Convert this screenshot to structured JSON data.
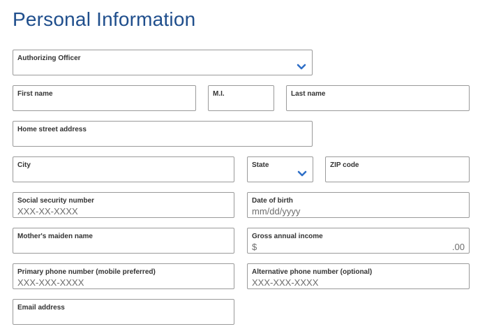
{
  "page": {
    "title": "Personal Information"
  },
  "colors": {
    "title": "#1f4e8c",
    "border": "#9a9a9a",
    "chevron": "#2f6fc7"
  },
  "fields": {
    "officer": {
      "label": "Authorizing Officer",
      "icon": "chevron-down-icon"
    },
    "first_name": {
      "label": "First name"
    },
    "mi": {
      "label": "M.I."
    },
    "last_name": {
      "label": "Last name"
    },
    "street": {
      "label": "Home street address"
    },
    "city": {
      "label": "City"
    },
    "state": {
      "label": "State",
      "icon": "chevron-down-icon"
    },
    "zip": {
      "label": "ZIP code"
    },
    "ssn": {
      "label": "Social security number",
      "placeholder": "XXX-XX-XXXX"
    },
    "dob": {
      "label": "Date of birth",
      "placeholder": "mm/dd/yyyy"
    },
    "maiden": {
      "label": "Mother's maiden name"
    },
    "income": {
      "label": "Gross annual income",
      "prefix": "$",
      "suffix": ".00"
    },
    "primary_phone": {
      "label": "Primary phone number (mobile preferred)",
      "placeholder": "XXX-XXX-XXXX"
    },
    "alt_phone": {
      "label": "Alternative phone number (optional)",
      "placeholder": "XXX-XXX-XXXX"
    },
    "email": {
      "label": "Email address"
    }
  }
}
